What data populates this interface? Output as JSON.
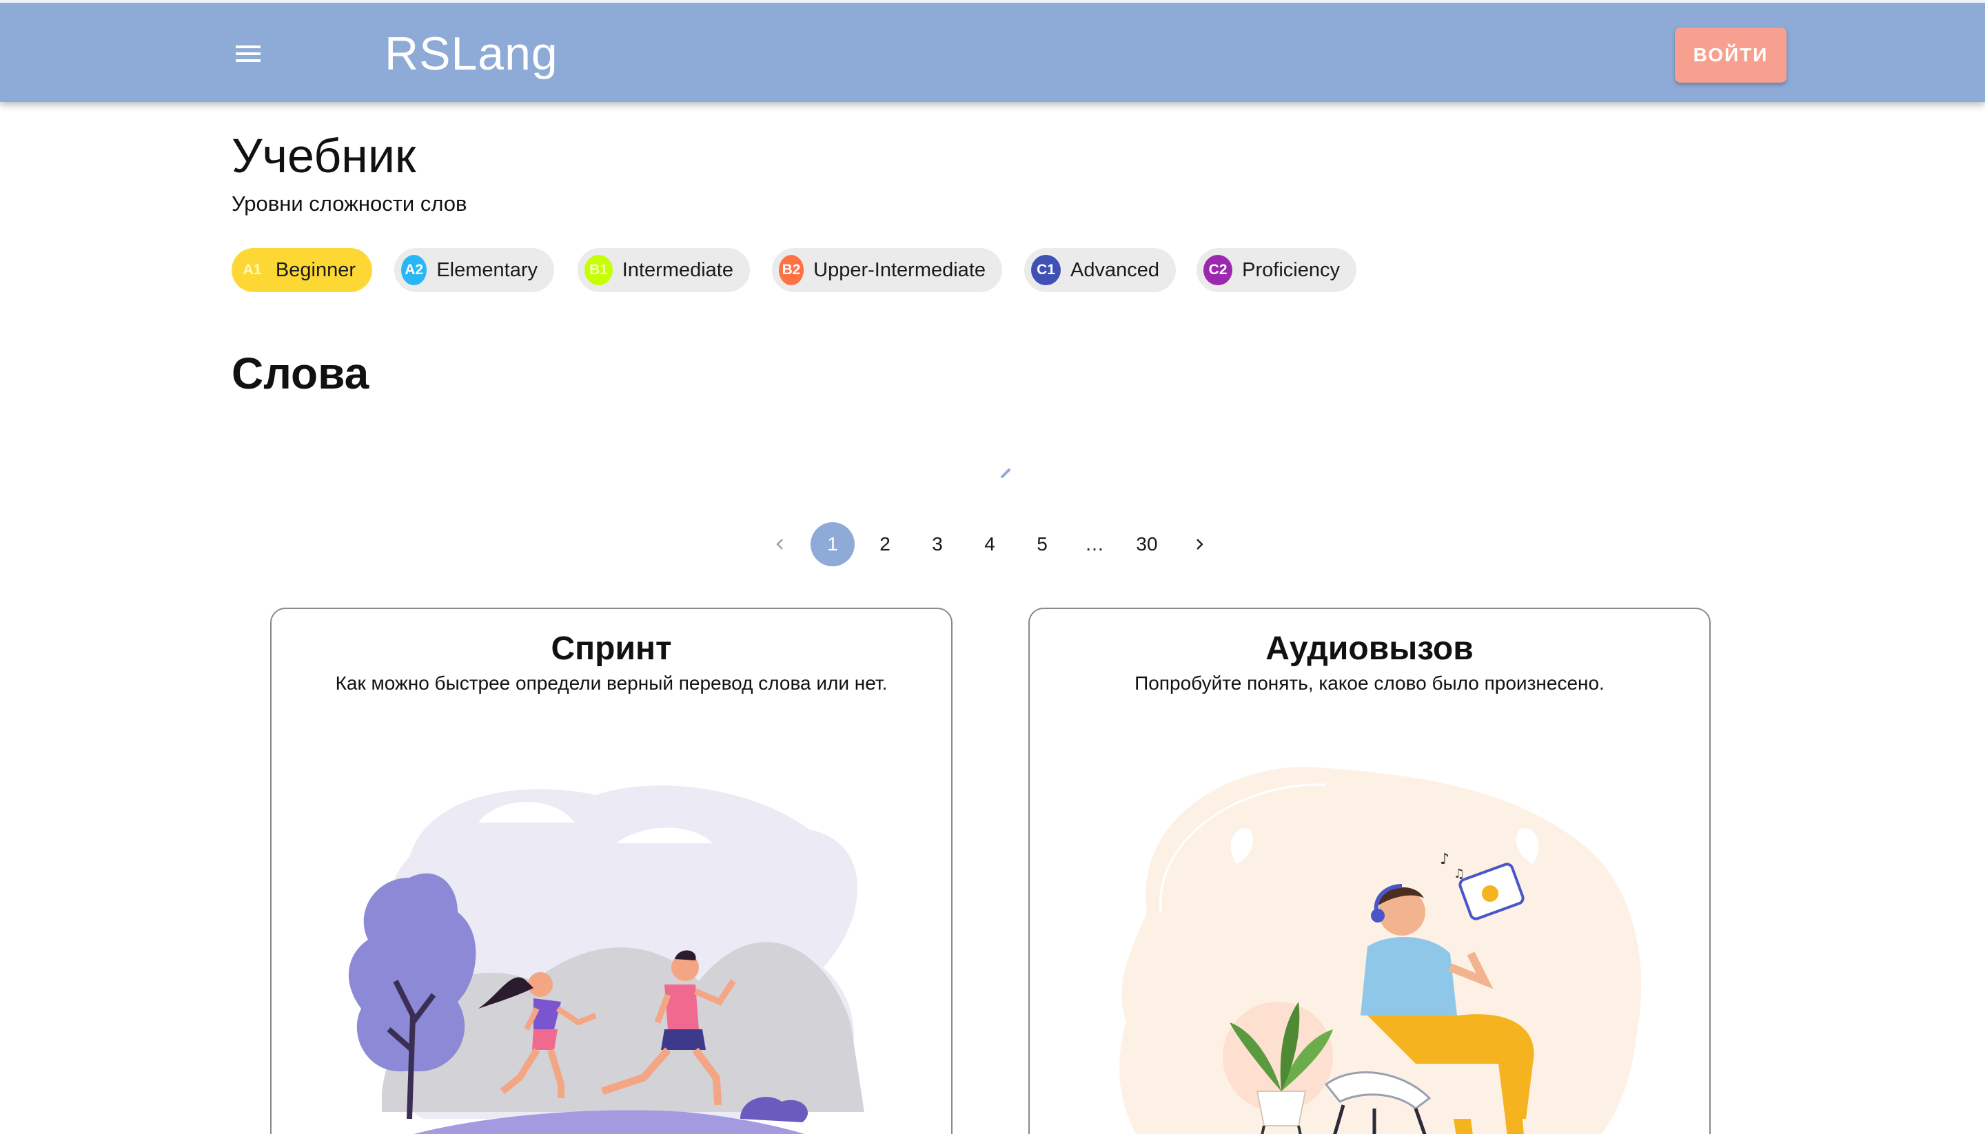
{
  "header": {
    "app_title": "RSLang",
    "login_label": "ВОЙТИ"
  },
  "textbook": {
    "title": "Учебник",
    "subtitle": "Уровни сложности слов",
    "levels": [
      {
        "code": "A1",
        "label": "Beginner",
        "color": "#fdd835",
        "active": true
      },
      {
        "code": "A2",
        "label": "Elementary",
        "color": "#29b6f6",
        "active": false
      },
      {
        "code": "B1",
        "label": "Intermediate",
        "color": "#c6ff00",
        "active": false
      },
      {
        "code": "B2",
        "label": "Upper-Intermediate",
        "color": "#ff7043",
        "active": false
      },
      {
        "code": "C1",
        "label": "Advanced",
        "color": "#3f51b5",
        "active": false
      },
      {
        "code": "C2",
        "label": "Proficiency",
        "color": "#9c27b0",
        "active": false
      }
    ]
  },
  "words": {
    "title": "Слова"
  },
  "pagination": {
    "pages": [
      "1",
      "2",
      "3",
      "4",
      "5",
      "…",
      "30"
    ],
    "current": "1"
  },
  "games": [
    {
      "title": "Спринт",
      "description": "Как можно быстрее определи верный перевод слова или нет."
    },
    {
      "title": "Аудиовызов",
      "description": "Попробуйте понять, какое слово было произнесено."
    }
  ]
}
